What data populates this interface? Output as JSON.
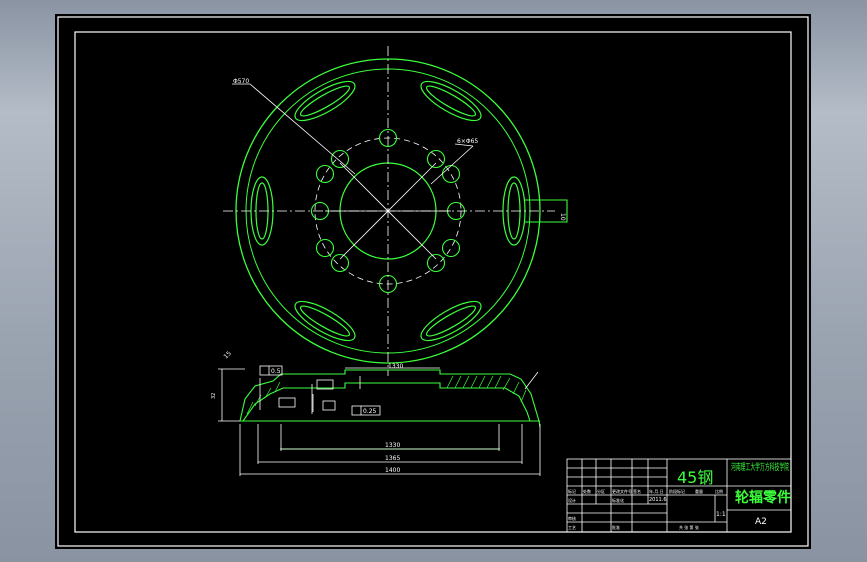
{
  "drawing": {
    "viewport_name": "model-space-viewport",
    "material": "45钢",
    "part_name": "轮辐零件",
    "school": "河南理工大学万方科技学院",
    "scale": "1:1",
    "sheet_size": "A2",
    "date": "2011.6",
    "dims": {
      "d1": "1400",
      "d2": "1365",
      "d3": "1330",
      "d4": "1330",
      "phi_top": "Φ570",
      "holes": "6×Φ65",
      "tol_a": "0.5",
      "tol_b": "0.25",
      "side": "32",
      "small1": "10",
      "small2": "15"
    },
    "title_block": {
      "r1": [
        "标记",
        "处数",
        "分区",
        "更改文件号",
        "签名",
        "年.月.日"
      ],
      "r2": [
        "设计",
        "",
        "标准化",
        "",
        "阶段标记",
        "重量",
        "比例"
      ],
      "r3": [
        "审核",
        "",
        "",
        "",
        "共 张 第 张"
      ],
      "r4": [
        "工艺",
        "",
        "批准",
        "",
        ""
      ]
    }
  },
  "colors": {
    "background": "#000000",
    "geometry": "#3cff3c",
    "text_and_frames": "#ffffff",
    "centerlines": "#ffffff"
  }
}
